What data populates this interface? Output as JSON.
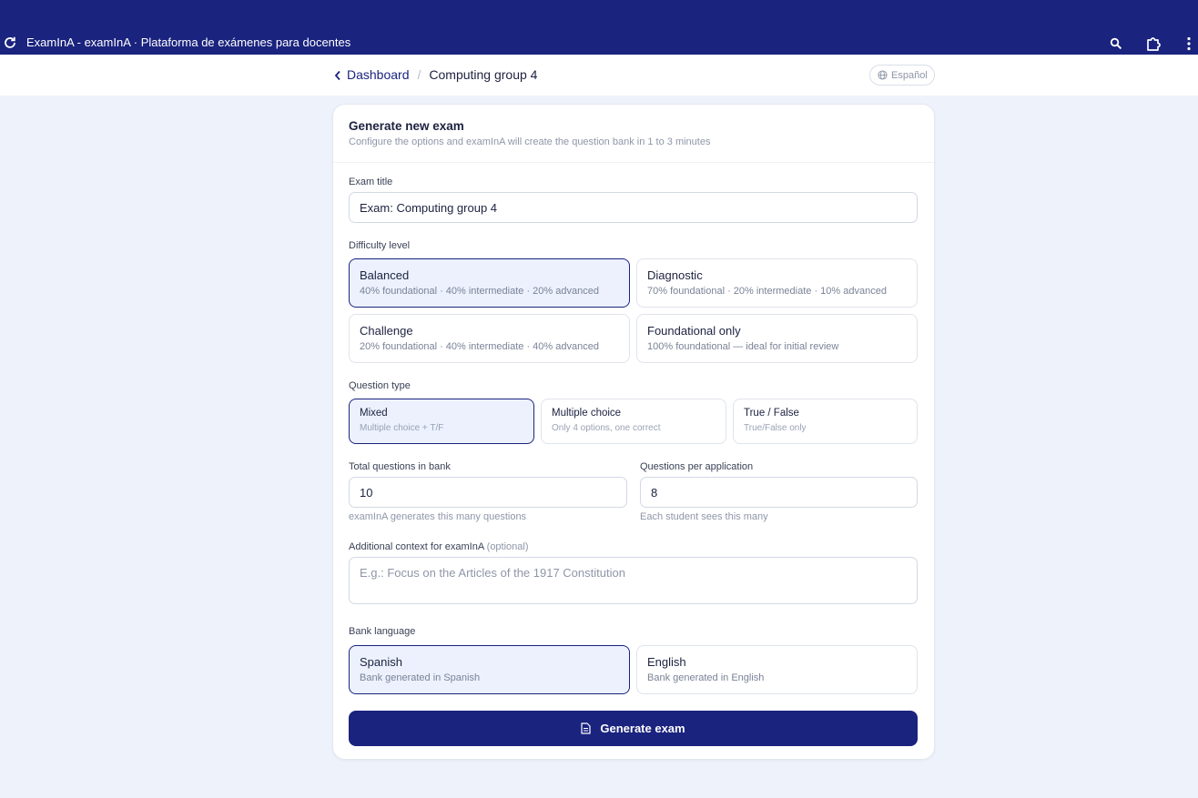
{
  "browser": {
    "window_title": "ExamInA - examInA · Plataforma de exámenes para docentes",
    "icons": [
      "reload-icon",
      "search-icon",
      "extensions-icon",
      "more-vert-icon"
    ]
  },
  "header": {
    "breadcrumb": {
      "back_label": "Dashboard",
      "separator": "/",
      "current": "Computing group 4"
    },
    "language_label": "Español"
  },
  "form": {
    "title": "Generate new exam",
    "subtitle": "Configure the options and examInA will create the question bank in 1 to 3 minutes",
    "exam_title": {
      "label": "Exam title",
      "value": "Exam: Computing group 4"
    },
    "difficulty": {
      "label": "Difficulty level",
      "options": [
        {
          "title": "Balanced",
          "desc": "40% foundational · 40% intermediate · 20% advanced",
          "selected": true
        },
        {
          "title": "Diagnostic",
          "desc": "70% foundational · 20% intermediate · 10% advanced",
          "selected": false
        },
        {
          "title": "Challenge",
          "desc": "20% foundational · 40% intermediate · 40% advanced",
          "selected": false
        },
        {
          "title": "Foundational only",
          "desc": "100% foundational — ideal for initial review",
          "selected": false
        }
      ]
    },
    "question_type": {
      "label": "Question type",
      "options": [
        {
          "title": "Mixed",
          "desc": "Multiple choice + T/F",
          "selected": true
        },
        {
          "title": "Multiple choice",
          "desc": "Only 4 options, one correct",
          "selected": false
        },
        {
          "title": "True / False",
          "desc": "True/False only",
          "selected": false
        }
      ]
    },
    "total_questions": {
      "label": "Total questions in bank",
      "value": "10",
      "hint": "examInA generates this many questions"
    },
    "per_application": {
      "label": "Questions per application",
      "value": "8",
      "hint": "Each student sees this many"
    },
    "context": {
      "label": "Additional context for examInA",
      "optional": "(optional)",
      "placeholder": "E.g.: Focus on the Articles of the 1917 Constitution"
    },
    "bank_language": {
      "label": "Bank language",
      "options": [
        {
          "title": "Spanish",
          "desc": "Bank generated in Spanish",
          "selected": true
        },
        {
          "title": "English",
          "desc": "Bank generated in English",
          "selected": false
        }
      ]
    },
    "submit_label": "Generate exam"
  },
  "colors": {
    "accent": "#1a237e",
    "page_bg": "#eef3fb",
    "selected_bg": "#ecf1fd"
  }
}
